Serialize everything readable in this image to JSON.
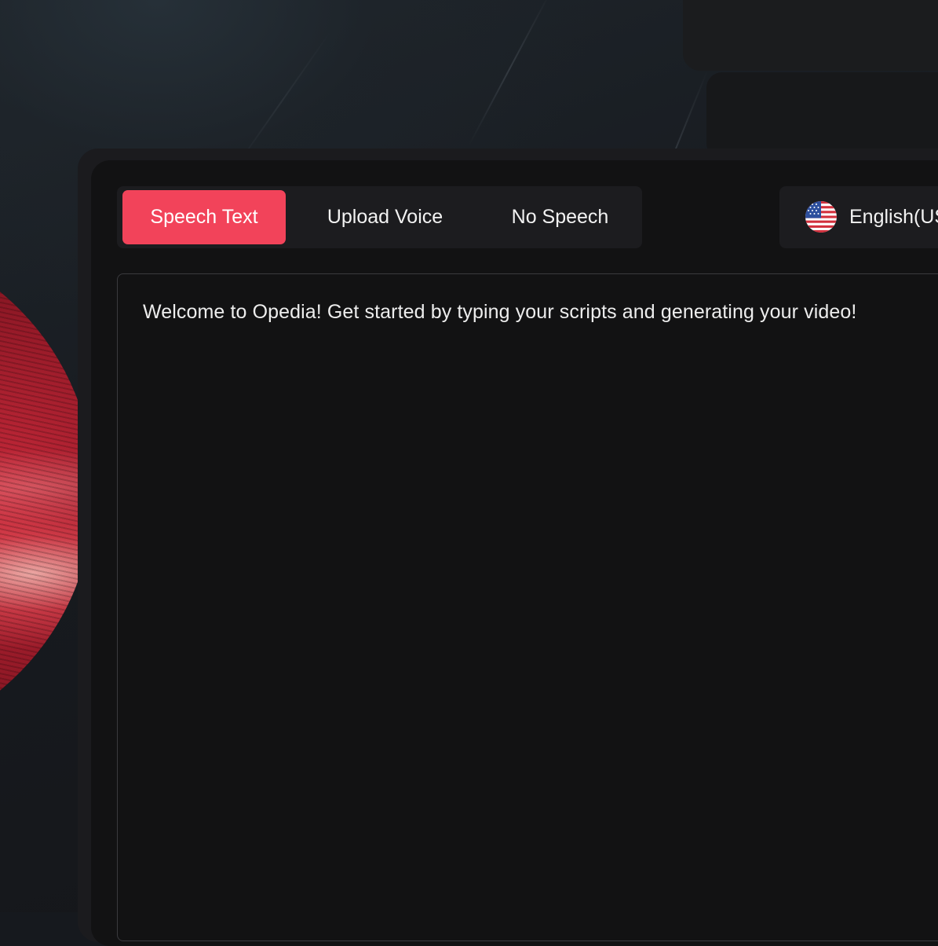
{
  "tabs": {
    "items": [
      {
        "label": "Speech Text",
        "active": true
      },
      {
        "label": "Upload Voice",
        "active": false
      },
      {
        "label": "No Speech",
        "active": false
      }
    ]
  },
  "language": {
    "label": "English(US)",
    "icon": "us-flag-icon"
  },
  "script": {
    "value": "Welcome to Opedia! Get started by typing your scripts and generating your video!"
  },
  "colors": {
    "accent": "#f2435a",
    "panel": "#1b1b1e",
    "editor": "#121213"
  }
}
